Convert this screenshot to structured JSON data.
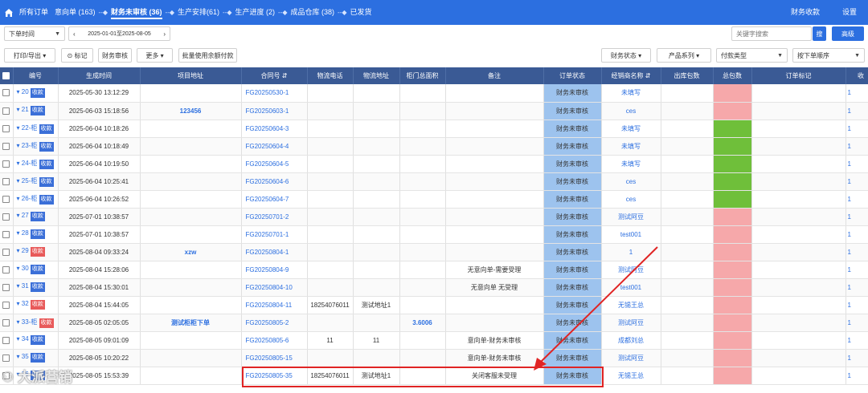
{
  "nav": {
    "items": [
      {
        "label": "所有订单"
      },
      {
        "label": "意向单 (163)"
      },
      {
        "label": "财务未审核 (36)"
      },
      {
        "label": "生产安排(61)"
      },
      {
        "label": "生产进度 (2)"
      },
      {
        "label": "成品仓库 (38)"
      },
      {
        "label": "已发货"
      }
    ],
    "separator": "--◆",
    "right": [
      "财务收款",
      "设置"
    ]
  },
  "filters": {
    "time_type": "下单时间",
    "date_range": "2025-01-01至2025-08-05",
    "search_placeholder": "关键字搜索",
    "search_button": "搜",
    "advanced_button": "高级"
  },
  "toolbar": {
    "print_export": "打印/导出",
    "mark": "标记",
    "finance_audit": "财务审核",
    "more": "更多",
    "batch_balance": "批量使用余额付款",
    "finance_status": "财务状态",
    "product_series": "产品系列",
    "payment_type": "付款类型",
    "order_sort": "按下单顺序"
  },
  "table": {
    "headers": [
      "编号",
      "生成时间",
      "项目地址",
      "合同号",
      "物流电话",
      "物流地址",
      "柜门总面积",
      "备注",
      "订单状态",
      "经销商名称",
      "出库包数",
      "总包数",
      "订单标记",
      "收"
    ],
    "badge_label": "收款",
    "rows": [
      {
        "no": "20",
        "badge": "blue",
        "time": "2025-05-30 13:12:29",
        "addr": "",
        "contract": "FG20250530-1",
        "phone": "",
        "ship_addr": "",
        "area": "",
        "remark": "",
        "status": "财务未审核",
        "dealer": "未填写",
        "pack_color": "red",
        "edge": "1"
      },
      {
        "no": "21",
        "badge": "blue",
        "time": "2025-06-03 15:18:56",
        "addr": "123456",
        "contract": "FG20250603-1",
        "phone": "",
        "ship_addr": "",
        "area": "",
        "remark": "",
        "status": "财务未审核",
        "dealer": "ces",
        "pack_color": "red",
        "edge": "1"
      },
      {
        "no": "22-柜",
        "badge": "blue",
        "time": "2025-06-04 10:18:26",
        "addr": "",
        "contract": "FG20250604-3",
        "phone": "",
        "ship_addr": "",
        "area": "",
        "remark": "",
        "status": "财务未审核",
        "dealer": "未填写",
        "pack_color": "green",
        "edge": "1"
      },
      {
        "no": "23-柜",
        "badge": "blue",
        "time": "2025-06-04 10:18:49",
        "addr": "",
        "contract": "FG20250604-4",
        "phone": "",
        "ship_addr": "",
        "area": "",
        "remark": "",
        "status": "财务未审核",
        "dealer": "未填写",
        "pack_color": "green",
        "edge": "1"
      },
      {
        "no": "24-柜",
        "badge": "blue",
        "time": "2025-06-04 10:19:50",
        "addr": "",
        "contract": "FG20250604-5",
        "phone": "",
        "ship_addr": "",
        "area": "",
        "remark": "",
        "status": "财务未审核",
        "dealer": "未填写",
        "pack_color": "green",
        "edge": "1"
      },
      {
        "no": "25-柜",
        "badge": "blue",
        "time": "2025-06-04 10:25:41",
        "addr": "",
        "contract": "FG20250604-6",
        "phone": "",
        "ship_addr": "",
        "area": "",
        "remark": "",
        "status": "财务未审核",
        "dealer": "ces",
        "pack_color": "green",
        "edge": "1"
      },
      {
        "no": "26-柜",
        "badge": "blue",
        "time": "2025-06-04 10:26:52",
        "addr": "",
        "contract": "FG20250604-7",
        "phone": "",
        "ship_addr": "",
        "area": "",
        "remark": "",
        "status": "财务未审核",
        "dealer": "ces",
        "pack_color": "green",
        "edge": "1"
      },
      {
        "no": "27",
        "badge": "blue",
        "time": "2025-07-01 10:38:57",
        "addr": "",
        "contract": "FG20250701-2",
        "phone": "",
        "ship_addr": "",
        "area": "",
        "remark": "",
        "status": "财务未审核",
        "dealer": "测试阿豆",
        "pack_color": "red",
        "edge": "1"
      },
      {
        "no": "28",
        "badge": "blue",
        "time": "2025-07-01 10:38:57",
        "addr": "",
        "contract": "FG20250701-1",
        "phone": "",
        "ship_addr": "",
        "area": "",
        "remark": "",
        "status": "财务未审核",
        "dealer": "test001",
        "pack_color": "red",
        "edge": "1"
      },
      {
        "no": "29",
        "badge": "red",
        "time": "2025-08-04 09:33:24",
        "addr": "xzw",
        "contract": "FG20250804-1",
        "phone": "",
        "ship_addr": "",
        "area": "",
        "remark": "",
        "status": "财务未审核",
        "dealer": "1",
        "pack_color": "red",
        "edge": "1"
      },
      {
        "no": "30",
        "badge": "blue",
        "time": "2025-08-04 15:28:06",
        "addr": "",
        "contract": "FG20250804-9",
        "phone": "",
        "ship_addr": "",
        "area": "",
        "remark": "无意向单-需要受理",
        "status": "财务未审核",
        "dealer": "测试阿豆",
        "pack_color": "red",
        "edge": "1"
      },
      {
        "no": "31",
        "badge": "blue",
        "time": "2025-08-04 15:30:01",
        "addr": "",
        "contract": "FG20250804-10",
        "phone": "",
        "ship_addr": "",
        "area": "",
        "remark": "无意向单 无受理",
        "status": "财务未审核",
        "dealer": "test001",
        "pack_color": "red",
        "edge": "1"
      },
      {
        "no": "32",
        "badge": "red",
        "time": "2025-08-04 15:44:05",
        "addr": "",
        "contract": "FG20250804-11",
        "phone": "18254076011",
        "ship_addr": "测试地址1",
        "area": "",
        "remark": "",
        "status": "财务未审核",
        "dealer": "无锡王总",
        "pack_color": "red",
        "edge": "1"
      },
      {
        "no": "33-柜",
        "badge": "red",
        "time": "2025-08-05 02:05:05",
        "addr": "测试柜柜下单",
        "contract": "FG20250805-2",
        "phone": "",
        "ship_addr": "",
        "area": "3.6006",
        "remark": "",
        "status": "财务未审核",
        "dealer": "测试阿豆",
        "pack_color": "red",
        "edge": "1"
      },
      {
        "no": "34",
        "badge": "blue",
        "time": "2025-08-05 09:01:09",
        "addr": "",
        "contract": "FG20250805-6",
        "phone": "11",
        "ship_addr": "11",
        "area": "",
        "remark": "意向单-财务未审核",
        "status": "财务未审核",
        "dealer": "成都刘总",
        "pack_color": "red",
        "edge": "1"
      },
      {
        "no": "35",
        "badge": "blue",
        "time": "2025-08-05 10:20:22",
        "addr": "",
        "contract": "FG20250805-15",
        "phone": "",
        "ship_addr": "",
        "area": "",
        "remark": "意向单-财务未审核",
        "status": "财务未审核",
        "dealer": "测试阿豆",
        "pack_color": "red",
        "edge": "1"
      },
      {
        "no": "36",
        "badge": "blue",
        "time": "2025-08-05 15:53:39",
        "addr": "",
        "contract": "FG20250805-35",
        "phone": "18254076011",
        "ship_addr": "测试地址1",
        "area": "",
        "remark": "关闭客服未受理",
        "status": "财务未审核",
        "dealer": "无锡王总",
        "pack_color": "red",
        "edge": "1"
      }
    ]
  },
  "watermark": "大派营销",
  "colors": {
    "nav_bg": "#2c6fe0",
    "header_bg": "#3a5a95",
    "status_bg": "#9dc3ee",
    "pack_red": "#f6a8aa",
    "pack_green": "#6fbf3a",
    "highlight": "#e02424"
  }
}
